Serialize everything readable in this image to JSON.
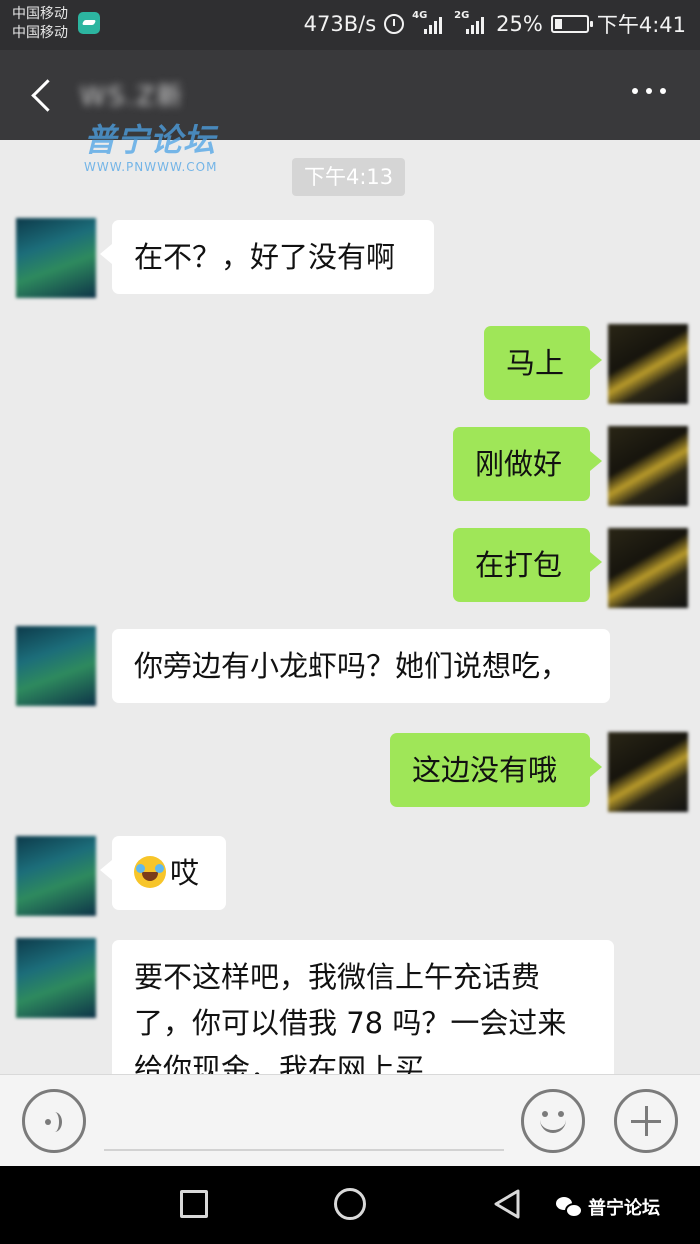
{
  "status_bar": {
    "carrier_1": "中国移动",
    "carrier_2": "中国移动",
    "net_speed": "473B/s",
    "net_4g": "4G",
    "net_2g": "2G",
    "battery": "25%",
    "battery_level": 0.25,
    "time": "下午4:41"
  },
  "header": {
    "title": "WS.Z新",
    "back_icon": "chevron-left-icon",
    "more_icon": "more-dots-icon"
  },
  "watermark": {
    "title": "普宁论坛",
    "url": "WWW.PNWWW.COM"
  },
  "timestamp": "下午4:13",
  "messages": [
    {
      "side": "in",
      "text": "在不？，好了没有啊"
    },
    {
      "side": "out",
      "text": "马上"
    },
    {
      "side": "out",
      "text": "刚做好"
    },
    {
      "side": "out",
      "text": "在打包"
    },
    {
      "side": "in",
      "text": "你旁边有小龙虾吗？她们说想吃，"
    },
    {
      "side": "out",
      "text": "这边没有哦"
    },
    {
      "side": "in",
      "text": "哎",
      "emoji": "crying-laughing-emoji-icon"
    },
    {
      "side": "in",
      "text": "要不这样吧，我微信上午充话费了，你可以借我 78 吗？一会过来给你现金，我在网上买"
    }
  ],
  "input_bar": {
    "voice_icon": "voice-icon",
    "emoji_icon": "smile-icon",
    "plus_icon": "plus-icon",
    "placeholder": ""
  },
  "nav_bar": {
    "wechat_account": "普宁论坛"
  },
  "colors": {
    "header_bg": "#39393b",
    "chat_bg": "#ebebeb",
    "out_bubble": "#9fe658",
    "in_bubble": "#ffffff"
  }
}
